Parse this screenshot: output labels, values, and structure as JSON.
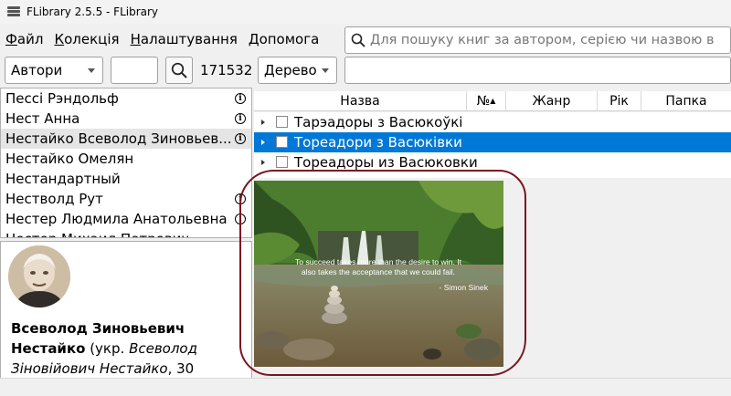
{
  "window": {
    "title": "FLibrary 2.5.5 - FLibrary"
  },
  "menu": [
    {
      "accel": "Ф",
      "rest": "айл"
    },
    {
      "accel": "К",
      "rest": "олекція"
    },
    {
      "accel": "Н",
      "rest": "алаштування"
    },
    {
      "accel": "Д",
      "rest": "опомога"
    }
  ],
  "search": {
    "placeholder": "Для пошуку книг за автором, серією чи назвою в"
  },
  "toolbar": {
    "group_by": "Автори",
    "filter_value": "",
    "count": "171532",
    "view_mode": "Дерево",
    "filter2_value": ""
  },
  "authors": [
    {
      "name": "Пессі Рэндольф",
      "info": "i"
    },
    {
      "name": "Нест Анна",
      "info": "i"
    },
    {
      "name": "Нестайко Всеволод Зиновьев...",
      "info": "i",
      "selected": true
    },
    {
      "name": "Нестайко Омелян",
      "info": ""
    },
    {
      "name": "Нестандартный",
      "info": ""
    },
    {
      "name": "Нестволд Рут",
      "info": "i"
    },
    {
      "name": "Нестер Людмила Анатольевна",
      "info": "i"
    },
    {
      "name": "Нестер Михаил Петрович",
      "info": ""
    }
  ],
  "author_bio": {
    "name_line1": "Всеволод Зиновьевич",
    "name_line2": "Нестайко",
    "paren_open": " (укр. ",
    "ua_name1": "Всеволод",
    "ua_name2": "Зіновійович Нестайко",
    "rest": ", 30"
  },
  "book_columns": [
    "Назва",
    "№",
    "Жанр",
    "Рік",
    "Папка"
  ],
  "books": [
    {
      "title": "Тарэадоры з Васюкоўкі"
    },
    {
      "title": "Тореадори з Васюківки",
      "selected": true
    },
    {
      "title": "Тореадоры из Васюковки"
    }
  ],
  "cover": {
    "quote_line1": "To succeed takes more than the desire to win. It",
    "quote_line2": "also takes the acceptance that we could fail.",
    "attribution": "- Simon Sinek"
  },
  "colors": {
    "selection": "#0078d7",
    "outline": "#7a1620"
  }
}
